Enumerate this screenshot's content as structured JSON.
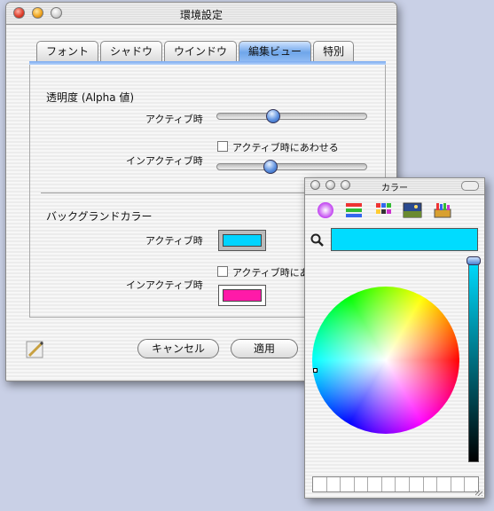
{
  "prefs": {
    "title": "環境設定",
    "tabs": [
      "フォント",
      "シャドウ",
      "ウインドウ",
      "編集ビュー",
      "特別"
    ],
    "active_tab": "編集ビュー",
    "alpha_heading": "透明度 (Alpha 値)",
    "active_label": "アクティブ時",
    "inactive_label": "インアクティブ時",
    "match_active_label": "アクティブ時にあわせる",
    "active_alpha": 0.36,
    "inactive_alpha": 0.34,
    "bg_heading": "バックグランドカラー",
    "bg_active_label": "アクティブ時",
    "bg_inactive_label": "インアクティブ時",
    "bg_match_label": "アクティブ時にあわせる",
    "bg_active_color": "#00d4ff",
    "bg_inactive_color": "#ff1aa8",
    "cancel_label": "キャンセル",
    "apply_label": "適用"
  },
  "colors": {
    "title": "カラー",
    "current_color": "#00dcff"
  }
}
